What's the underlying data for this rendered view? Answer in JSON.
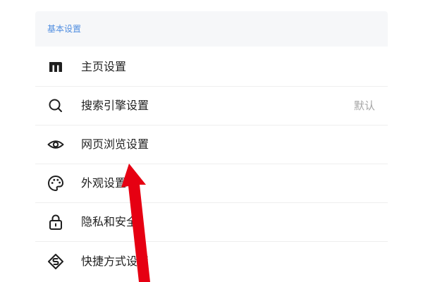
{
  "section": {
    "title": "基本设置"
  },
  "items": [
    {
      "icon": "home-logo-icon",
      "label": "主页设置",
      "value": ""
    },
    {
      "icon": "search-icon",
      "label": "搜索引擎设置",
      "value": "默认"
    },
    {
      "icon": "eye-icon",
      "label": "网页浏览设置",
      "value": ""
    },
    {
      "icon": "palette-icon",
      "label": "外观设置",
      "value": ""
    },
    {
      "icon": "lock-icon",
      "label": "隐私和安全",
      "value": ""
    },
    {
      "icon": "shortcut-icon",
      "label": "快捷方式设置",
      "value": ""
    }
  ],
  "annotation": {
    "icon": "red-arrow-icon",
    "color": "#e60012"
  }
}
